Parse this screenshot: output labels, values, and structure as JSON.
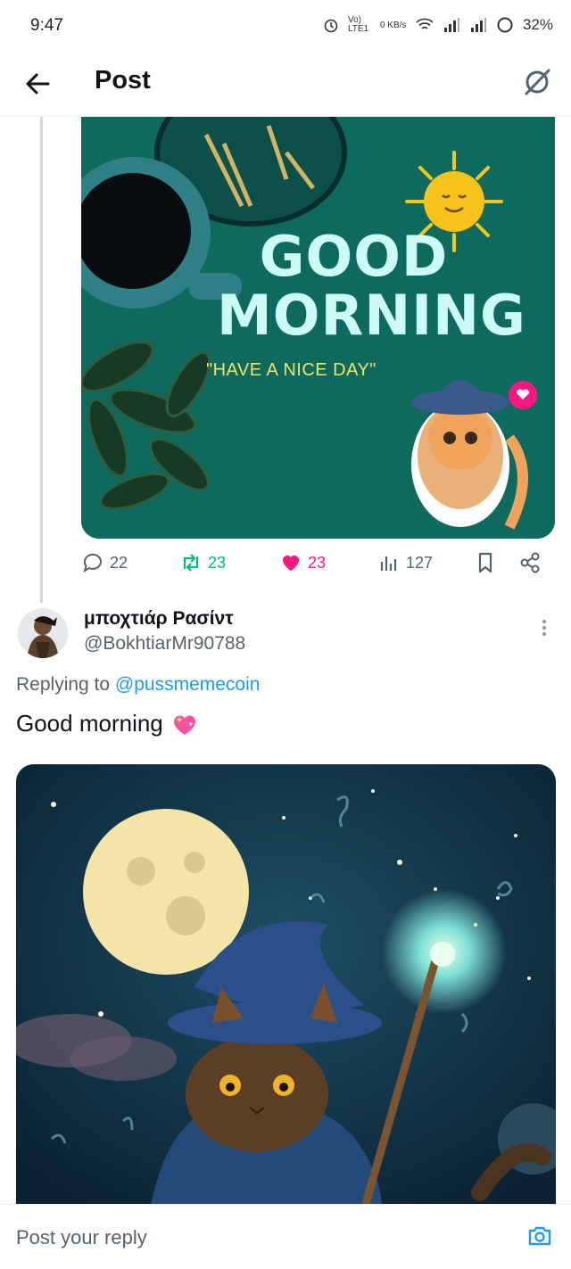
{
  "status_bar": {
    "time": "9:47",
    "network": "Vo) LTE1",
    "data_rate": "0 KB/s",
    "battery": "32%"
  },
  "header": {
    "title": "Post"
  },
  "previous_post": {
    "image": {
      "line1": "GOOD",
      "line2": "MORNING",
      "tagline": "\"HAVE A NICE DAY\""
    },
    "stats": {
      "replies": "22",
      "reposts": "23",
      "likes": "23",
      "views": "127"
    },
    "colors": {
      "repost": "#00ba7c",
      "like": "#f91880",
      "muted": "#536471"
    }
  },
  "reply": {
    "display_name": "μποχτιάρ Ρασίντ",
    "handle": "@BokhtiarMr90788",
    "replying_prefix": "Replying to",
    "replying_to": "@pussmemecoin",
    "text": "Good morning"
  },
  "reply_bar": {
    "placeholder": "Post your reply"
  },
  "colors": {
    "accent": "#1d9bf0",
    "text": "#0f1419",
    "secondary": "#536471"
  }
}
